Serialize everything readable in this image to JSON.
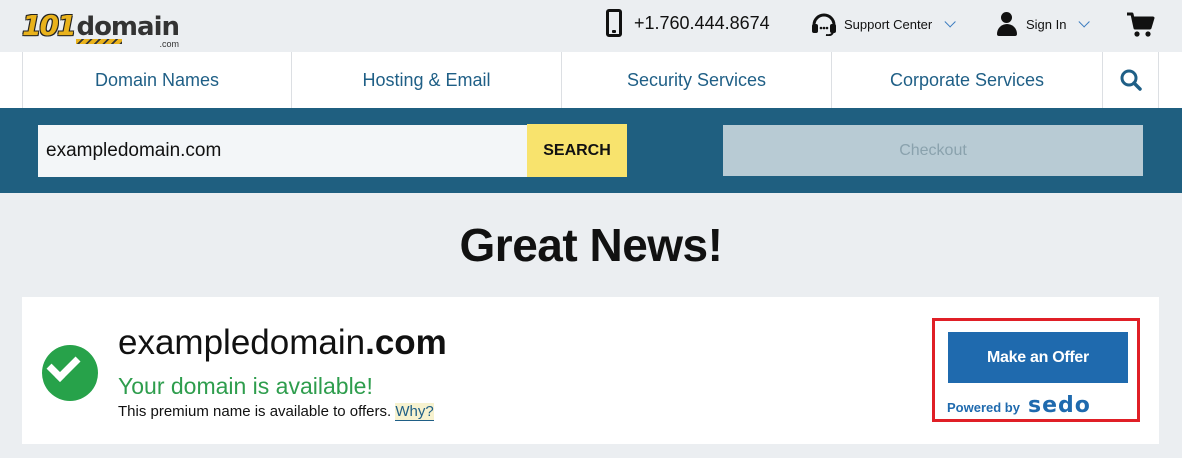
{
  "header": {
    "logo_number": "101",
    "logo_word": "domain",
    "logo_suffix": ".com",
    "phone": "+1.760.444.8674",
    "support_label": "Support Center",
    "signin_label": "Sign In"
  },
  "nav": {
    "items": [
      {
        "label": "Domain Names"
      },
      {
        "label": "Hosting & Email"
      },
      {
        "label": "Security Services"
      },
      {
        "label": "Corporate Services"
      }
    ]
  },
  "search": {
    "value": "exampledomain.com",
    "button_label": "SEARCH",
    "checkout_label": "Checkout"
  },
  "result": {
    "headline": "Great News!",
    "domain_sld": "exampledomain",
    "domain_tld": ".com",
    "status": "Your domain is available!",
    "note": "This premium name is available to offers.",
    "why_label": "Why?",
    "offer_label": "Make an Offer",
    "powered_by": "Powered by",
    "partner": "sedo"
  },
  "colors": {
    "brand_blue": "#1f5f80",
    "accent_yellow": "#f8e36d",
    "success_green": "#27a24a",
    "offer_blue": "#1f6aae",
    "highlight_red": "#e01f26"
  }
}
